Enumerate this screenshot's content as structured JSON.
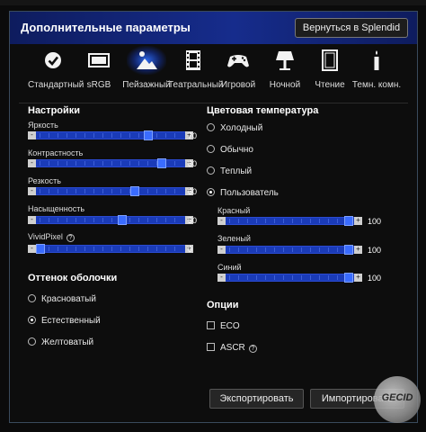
{
  "window": {
    "title": "Дополнительные параметры",
    "back_button": "Вернуться в Splendid"
  },
  "modes": [
    {
      "label": "Стандартный",
      "icon": "check-circle-icon"
    },
    {
      "label": "sRGB",
      "icon": "monitor-icon"
    },
    {
      "label": "Пейзажный",
      "icon": "landscape-icon",
      "active": true
    },
    {
      "label": "Театральный",
      "icon": "film-icon"
    },
    {
      "label": "Игровой",
      "icon": "gamepad-icon"
    },
    {
      "label": "Ночной",
      "icon": "night-lamp-icon"
    },
    {
      "label": "Чтение",
      "icon": "book-icon"
    },
    {
      "label": "Темн. комн.",
      "icon": "candle-icon"
    }
  ],
  "settings": {
    "title": "Настройки",
    "brightness": {
      "label": "Яркость",
      "value": "70"
    },
    "contrast": {
      "label": "Контрастность",
      "value": "80"
    },
    "sharpness": {
      "label": "Резкость",
      "value": "60"
    },
    "saturation": {
      "label": "Насыщенность",
      "value": "50"
    },
    "vividpixel": {
      "label": "VividPixel",
      "value": "0"
    }
  },
  "skin_tone": {
    "title": "Оттенок оболочки",
    "options": [
      "Красноватый",
      "Естественный",
      "Желтоватый"
    ],
    "selected": "Естественный"
  },
  "color_temp": {
    "title": "Цветовая температура",
    "options": [
      "Холодный",
      "Обычно",
      "Теплый",
      "Пользователь"
    ],
    "selected": "Пользователь",
    "red": {
      "label": "Красный",
      "value": "100"
    },
    "green": {
      "label": "Зеленый",
      "value": "100"
    },
    "blue": {
      "label": "Синий",
      "value": "100"
    }
  },
  "options": {
    "title": "Опции",
    "eco": "ECO",
    "ascr": "ASCR"
  },
  "footer": {
    "export": "Экспортировать",
    "import": "Импортировать"
  },
  "watermark": "GECID",
  "colors": {
    "titlebar": "#162c8c",
    "accent": "#2a4ad0",
    "slider_fill": "#1a3bb8"
  }
}
